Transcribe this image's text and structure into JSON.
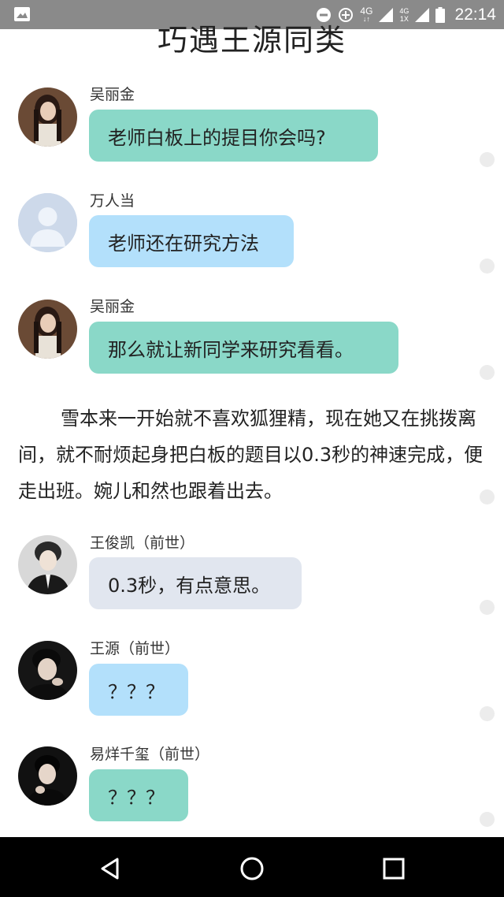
{
  "status_bar": {
    "time": "22:14",
    "network_top": "4G",
    "network_small_top": "4G",
    "network_small_bottom": "1X"
  },
  "title": "巧遇王源同类",
  "messages": [
    {
      "sender": "吴丽金",
      "text": "老师白板上的提目你会吗?",
      "bubble_color": "#8ad8c8"
    },
    {
      "sender": "万人当",
      "text": "老师还在研究方法",
      "bubble_color": "#b3e0fb"
    },
    {
      "sender": "吴丽金",
      "text": "那么就让新同学来研究看看。",
      "bubble_color": "#8ad8c8"
    },
    {
      "sender": "王俊凯（前世）",
      "text": "0.3秒，有点意思。",
      "bubble_color": "#e1e6ef"
    },
    {
      "sender": "王源（前世）",
      "text": "？？？",
      "bubble_color": "#b3e0fb"
    },
    {
      "sender": "易烊千玺（前世）",
      "text": "？？？",
      "bubble_color": "#8ad8c8"
    }
  ],
  "narration": "雪本来一开始就不喜欢狐狸精，现在她又在挑拨离间，就不耐烦起身把白板的题目以0.3秒的神速完成，便走出班。婉儿和然也跟着出去。",
  "nav": {
    "back_icon": "triangle-back-icon",
    "home_icon": "circle-home-icon",
    "recents_icon": "square-recents-icon"
  }
}
